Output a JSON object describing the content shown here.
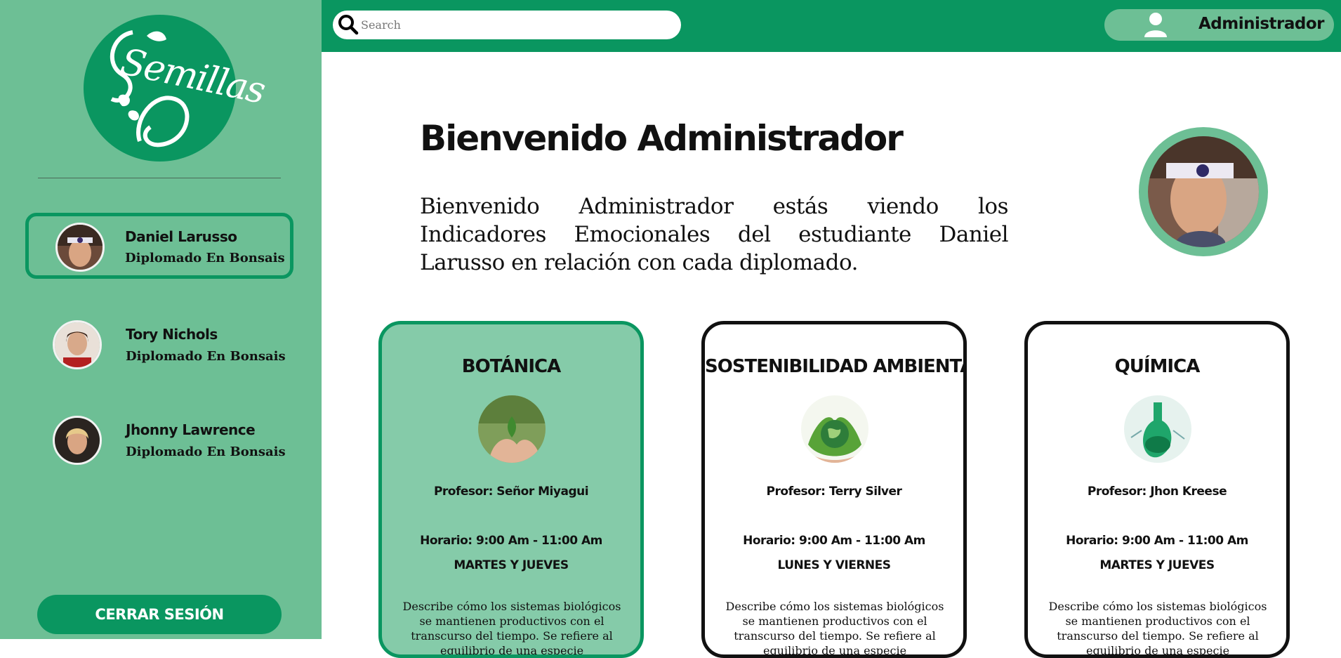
{
  "logo": {
    "text": "Semillas"
  },
  "search": {
    "placeholder": "Search"
  },
  "user": {
    "label": "Administrador"
  },
  "students": [
    {
      "name": "Daniel Larusso",
      "course": "Diplomado En Bonsais",
      "active": true
    },
    {
      "name": "Tory Nichols",
      "course": "Diplomado En Bonsais",
      "active": false
    },
    {
      "name": "Jhonny Lawrence",
      "course": "Diplomado En Bonsais",
      "active": false
    }
  ],
  "logout_label": "CERRAR SESIÓN",
  "welcome": {
    "title": "Bienvenido Administrador",
    "text": "Bienvenido Administrador estás viendo los Indicadores Emocionales del estudiante Daniel Larusso en relación con cada diplomado."
  },
  "courses": [
    {
      "title": "BOTÁNICA",
      "professor": "Profesor: Señor Miyagui",
      "schedule": "Horario: 9:00 Am - 11:00 Am",
      "days": "MARTES Y JUEVES",
      "description": "Describe cómo los sistemas biológicos se mantienen productivos con el transcurso del tiempo. Se refiere al equilibrio de una especie",
      "active": true
    },
    {
      "title": "SOSTENIBILIDAD AMBIENTAL",
      "professor": "Profesor: Terry Silver",
      "schedule": "Horario: 9:00 Am - 11:00 Am",
      "days": "LUNES Y VIERNES",
      "description": "Describe cómo los sistemas biológicos se mantienen productivos con el transcurso del tiempo. Se refiere al equilibrio de una especie",
      "active": false
    },
    {
      "title": "QUÍMICA",
      "professor": "Profesor: Jhon Kreese",
      "schedule": "Horario: 9:00 Am - 11:00 Am",
      "days": "MARTES Y JUEVES",
      "description": "Describe cómo los sistemas biológicos se mantienen productivos con el transcurso del tiempo. Se refiere al equilibrio de una especie",
      "active": false
    }
  ],
  "colors": {
    "brand_green": "#0a9660",
    "sidebar_green": "#6dbf95",
    "active_card": "#85cba9"
  },
  "icons": [
    "search-icon",
    "user-icon",
    "logo-leaf-icon"
  ]
}
